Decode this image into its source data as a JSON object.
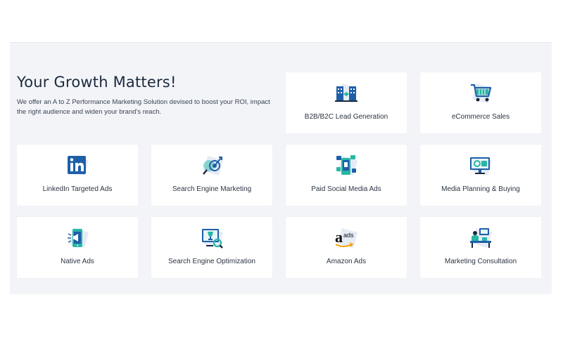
{
  "intro": {
    "title": "Your Growth Matters!",
    "description": "We offer an A to Z Performance Marketing Solution devised to boost your ROI, impact the right audience and widen your brand's reach."
  },
  "services": [
    {
      "label": "B2B/B2C Lead Generation",
      "icon": "buildings-handshake-icon"
    },
    {
      "label": "eCommerce Sales",
      "icon": "shopping-cart-icon"
    },
    {
      "label": "LinkedIn Targeted Ads",
      "icon": "linkedin-icon"
    },
    {
      "label": "Search Engine Marketing",
      "icon": "search-target-icon"
    },
    {
      "label": "Paid Social Media Ads",
      "icon": "social-phone-icon"
    },
    {
      "label": "Media Planning & Buying",
      "icon": "monitor-media-icon"
    },
    {
      "label": "Native Ads",
      "icon": "phone-megaphone-icon"
    },
    {
      "label": "Search Engine Optimization",
      "icon": "seo-monitor-icon"
    },
    {
      "label": "Amazon Ads",
      "icon": "amazon-ads-icon",
      "logo_text": "ads"
    },
    {
      "label": "Marketing Consultation",
      "icon": "consultation-desk-icon"
    }
  ],
  "colors": {
    "primary": "#1e5fa8",
    "accent": "#27b7a6",
    "decor": "#e6ebf5",
    "background": "#f3f4f8"
  }
}
